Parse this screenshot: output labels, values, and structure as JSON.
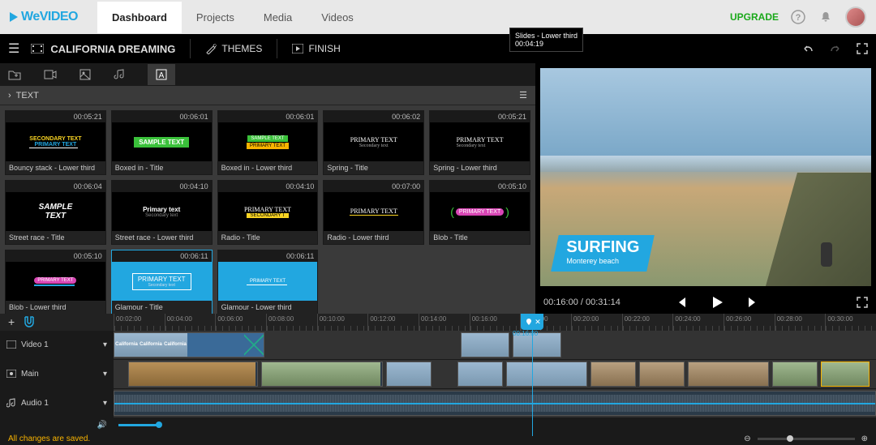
{
  "brand": "WeVIDEO",
  "nav": {
    "dashboard": "Dashboard",
    "projects": "Projects",
    "media": "Media",
    "videos": "Videos"
  },
  "upgrade": "UPGRADE",
  "project": {
    "title": "CALIFORNIA DREAMING",
    "themes": "THEMES",
    "finish": "FINISH"
  },
  "library": {
    "header": "TEXT",
    "items": [
      {
        "dur": "00:05:21",
        "name": "Bouncy stack - Lower third",
        "style": "bouncy"
      },
      {
        "dur": "00:06:01",
        "name": "Boxed in - Title",
        "style": "boxed"
      },
      {
        "dur": "00:06:01",
        "name": "Boxed in - Lower third",
        "style": "boxedlt"
      },
      {
        "dur": "00:06:02",
        "name": "Spring - Title",
        "style": "spring"
      },
      {
        "dur": "00:05:21",
        "name": "Spring - Lower third",
        "style": "springlt"
      },
      {
        "dur": "00:06:04",
        "name": "Street race - Title",
        "style": "street"
      },
      {
        "dur": "00:04:10",
        "name": "Street race - Lower third",
        "style": "streetlt"
      },
      {
        "dur": "00:04:10",
        "name": "Radio - Title",
        "style": "radio"
      },
      {
        "dur": "00:07:00",
        "name": "Radio - Lower third",
        "style": "radiolt"
      },
      {
        "dur": "00:05:10",
        "name": "Blob - Title",
        "style": "blob"
      },
      {
        "dur": "00:05:10",
        "name": "Blob - Lower third",
        "style": "bloblt"
      },
      {
        "dur": "00:06:11",
        "name": "Glamour - Title",
        "style": "glamour",
        "selected": true
      },
      {
        "dur": "00:06:11",
        "name": "Glamour - Lower third",
        "style": "glamourlt"
      }
    ],
    "sample": {
      "primary": "PRIMARY TEXT",
      "secondary": "Secondary text",
      "sample": "SAMPLE TEXT"
    }
  },
  "preview": {
    "title": "SURFING",
    "subtitle": "Monterey beach",
    "current": "00:16:00",
    "total": "00:31:14"
  },
  "timeline": {
    "ticks": [
      "00:02:00",
      "00:04:00",
      "00:06:00",
      "00:08:00",
      "00:10:00",
      "00:12:00",
      "00:14:00",
      "00:16:00",
      "00:18:00",
      "00:20:00",
      "00:22:00",
      "00:24:00",
      "00:26:00",
      "00:28:00",
      "00:30:00"
    ],
    "playhead": "00:16:00",
    "tooltip": {
      "name": "Slides - Lower third",
      "dur": "00:04:19"
    },
    "tracks": {
      "video1": "Video 1",
      "main": "Main",
      "audio1": "Audio 1"
    },
    "clipLabel": "California"
  },
  "footer": {
    "status": "All changes are saved."
  }
}
